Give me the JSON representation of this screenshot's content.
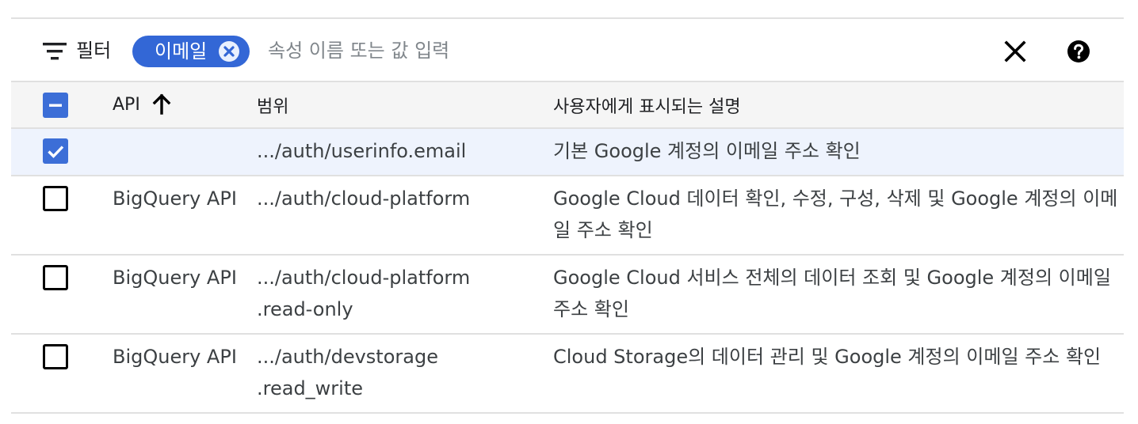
{
  "filter_bar": {
    "filter_label": "필터",
    "chip_label": "이메일",
    "input_placeholder": "속성 이름 또는 값 입력",
    "input_value": ""
  },
  "table": {
    "headers": {
      "api": "API",
      "scope": "범위",
      "description": "사용자에게 표시되는 설명"
    },
    "header_checkbox_state": "indeterminate",
    "sort": {
      "column": "api",
      "direction": "ascending"
    },
    "rows": [
      {
        "checked": true,
        "api": "",
        "scope_line1": ".../auth/userinfo.email",
        "scope_line2": "",
        "description": "기본 Google 계정의 이메일 주소 확인"
      },
      {
        "checked": false,
        "api": "BigQuery API",
        "scope_line1": ".../auth/cloud-platform",
        "scope_line2": "",
        "description": "Google Cloud 데이터 확인, 수정, 구성, 삭제 및 Google 계정의 이메일 주소 확인"
      },
      {
        "checked": false,
        "api": "BigQuery API",
        "scope_line1": ".../auth/cloud-platform",
        "scope_line2": ".read-only",
        "description": "Google Cloud 서비스 전체의 데이터 조회 및 Google 계정의 이메일 주소 확인"
      },
      {
        "checked": false,
        "api": "BigQuery API",
        "scope_line1": ".../auth/devstorage",
        "scope_line2": ".read_write",
        "description": "Cloud Storage의 데이터 관리 및 Google 계정의 이메일 주소 확인"
      }
    ]
  },
  "colors": {
    "chip_background": "#3367d6",
    "checkbox_checked": "#3c6ed7",
    "selected_row_background": "#eef3fd",
    "header_background": "#f5f5f5",
    "divider": "#e0e0e0"
  },
  "icons": {
    "filter": "filter-list-icon",
    "chip_remove": "cancel-circle-icon",
    "clear": "close-icon",
    "help": "help-circle-icon",
    "sort": "arrow-up-icon",
    "checkbox_checked": "check-icon",
    "checkbox_indeterminate": "minus-icon"
  }
}
